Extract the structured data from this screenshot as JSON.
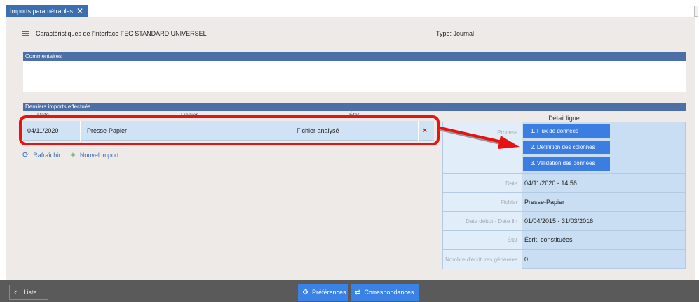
{
  "tab": {
    "label": "Imports paramétrables",
    "close": "✕"
  },
  "header": {
    "title": "Caractéristiques de l'interface FEC STANDARD UNIVERSEL",
    "type": "Type: Journal"
  },
  "sections": {
    "comments": "Commentaires",
    "last_imports": "Derniers imports effectués"
  },
  "columns": {
    "date": "Date",
    "file": "Fichier",
    "state": "État"
  },
  "import_row": {
    "date": "04/11/2020",
    "file": "Presse-Papier",
    "state": "Fichier analysé",
    "delete": "×"
  },
  "actions": {
    "refresh": "Rafraîchir",
    "new_import": "Nouvel import"
  },
  "detail": {
    "title": "Détail ligne",
    "process_label": "Process",
    "process_steps": [
      "1. Flux de données",
      "2. Définition des colonnes",
      "3. Validation des données"
    ],
    "rows": [
      {
        "label": "Date",
        "value": "04/11/2020 - 14:56"
      },
      {
        "label": "Fichier",
        "value": "Presse-Papier"
      },
      {
        "label": "Date début - Date fin",
        "value": "01/04/2015 - 31/03/2016"
      },
      {
        "label": "État",
        "value": "Écrit. constituées"
      },
      {
        "label": "Nombre d'écritures générées",
        "value": "0"
      }
    ]
  },
  "bottom": {
    "list": "Liste",
    "preferences": "Préférences",
    "mappings": "Correspondances"
  },
  "colors": {
    "accent": "#3b7de0",
    "highlight": "#e81212",
    "section": "#4c6fa8"
  }
}
